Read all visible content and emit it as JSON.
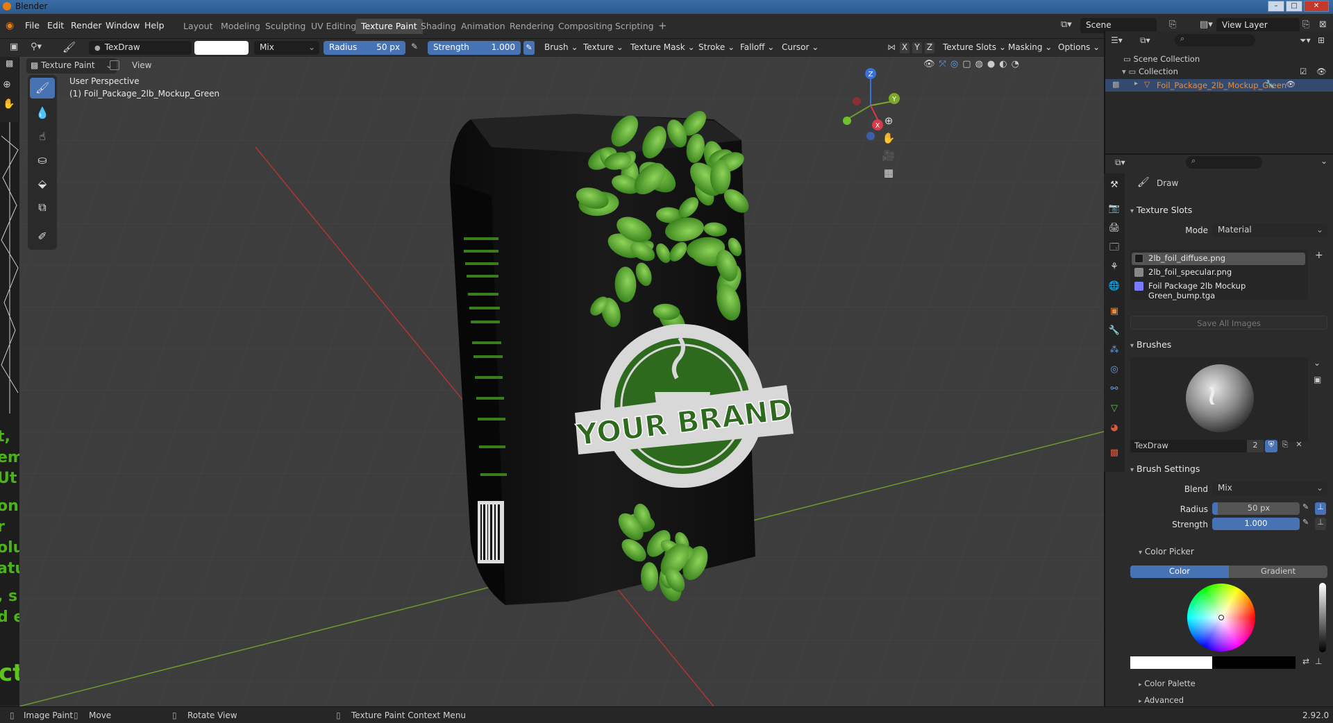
{
  "window": {
    "title": "Blender"
  },
  "menubar": {
    "items": [
      "File",
      "Edit",
      "Render",
      "Window",
      "Help"
    ],
    "workspaces": [
      "Layout",
      "Modeling",
      "Sculpting",
      "UV Editing",
      "Texture Paint",
      "Shading",
      "Animation",
      "Rendering",
      "Compositing",
      "Scripting"
    ],
    "active_workspace": "Texture Paint",
    "scene": "Scene",
    "view_layer": "View Layer"
  },
  "toolheader": {
    "brush_name": "TexDraw",
    "blend": "Mix",
    "radius_label": "Radius",
    "radius_value": "50 px",
    "strength_label": "Strength",
    "strength_value": "1.000",
    "dropdowns": [
      "Brush",
      "Texture",
      "Texture Mask",
      "Stroke",
      "Falloff",
      "Cursor"
    ],
    "axes": [
      "X",
      "Y",
      "Z"
    ],
    "right_dropdowns": [
      "Texture Slots",
      "Masking",
      "Options"
    ]
  },
  "viewport": {
    "mode": "Texture Paint",
    "view_menu": "View",
    "perspective": "User Perspective",
    "object_label": "(1) Foil_Package_2lb_Mockup_Green",
    "brand_text": "YOUR BRAND",
    "gizmo": {
      "x": "X",
      "y": "Y",
      "z": "Z"
    }
  },
  "outliner": {
    "scene_collection": "Scene Collection",
    "collection": "Collection",
    "object": "Foil_Package_2lb_Mockup_Green"
  },
  "properties": {
    "tool_name": "Draw",
    "texture_slots": {
      "title": "Texture Slots",
      "mode_label": "Mode",
      "mode_value": "Material",
      "slots": [
        {
          "name": "2lb_foil_diffuse.png",
          "color": "#1a1a1a"
        },
        {
          "name": "2lb_foil_specular.png",
          "color": "#888888"
        },
        {
          "name": "Foil Package 2lb Mockup Green_bump.tga",
          "color": "#7a7aff"
        }
      ],
      "save_all": "Save All Images"
    },
    "brushes": {
      "title": "Brushes",
      "brush_name": "TexDraw",
      "users": "2"
    },
    "brush_settings": {
      "title": "Brush Settings",
      "blend_label": "Blend",
      "blend_value": "Mix",
      "radius_label": "Radius",
      "radius_value": "50 px",
      "strength_label": "Strength",
      "strength_value": "1.000",
      "color_picker": "Color Picker",
      "tab_color": "Color",
      "tab_gradient": "Gradient",
      "color_palette": "Color Palette",
      "advanced": "Advanced"
    }
  },
  "statusbar": {
    "image_paint": "Image Paint",
    "move": "Move",
    "rotate_view": "Rotate View",
    "context_menu": "Texture Paint Context Menu",
    "version": "2.92.0"
  },
  "colors": {
    "accent": "#4772b3",
    "leaf": "#4c9a2a",
    "package": "#111111",
    "badge": "#2d6a1e"
  }
}
